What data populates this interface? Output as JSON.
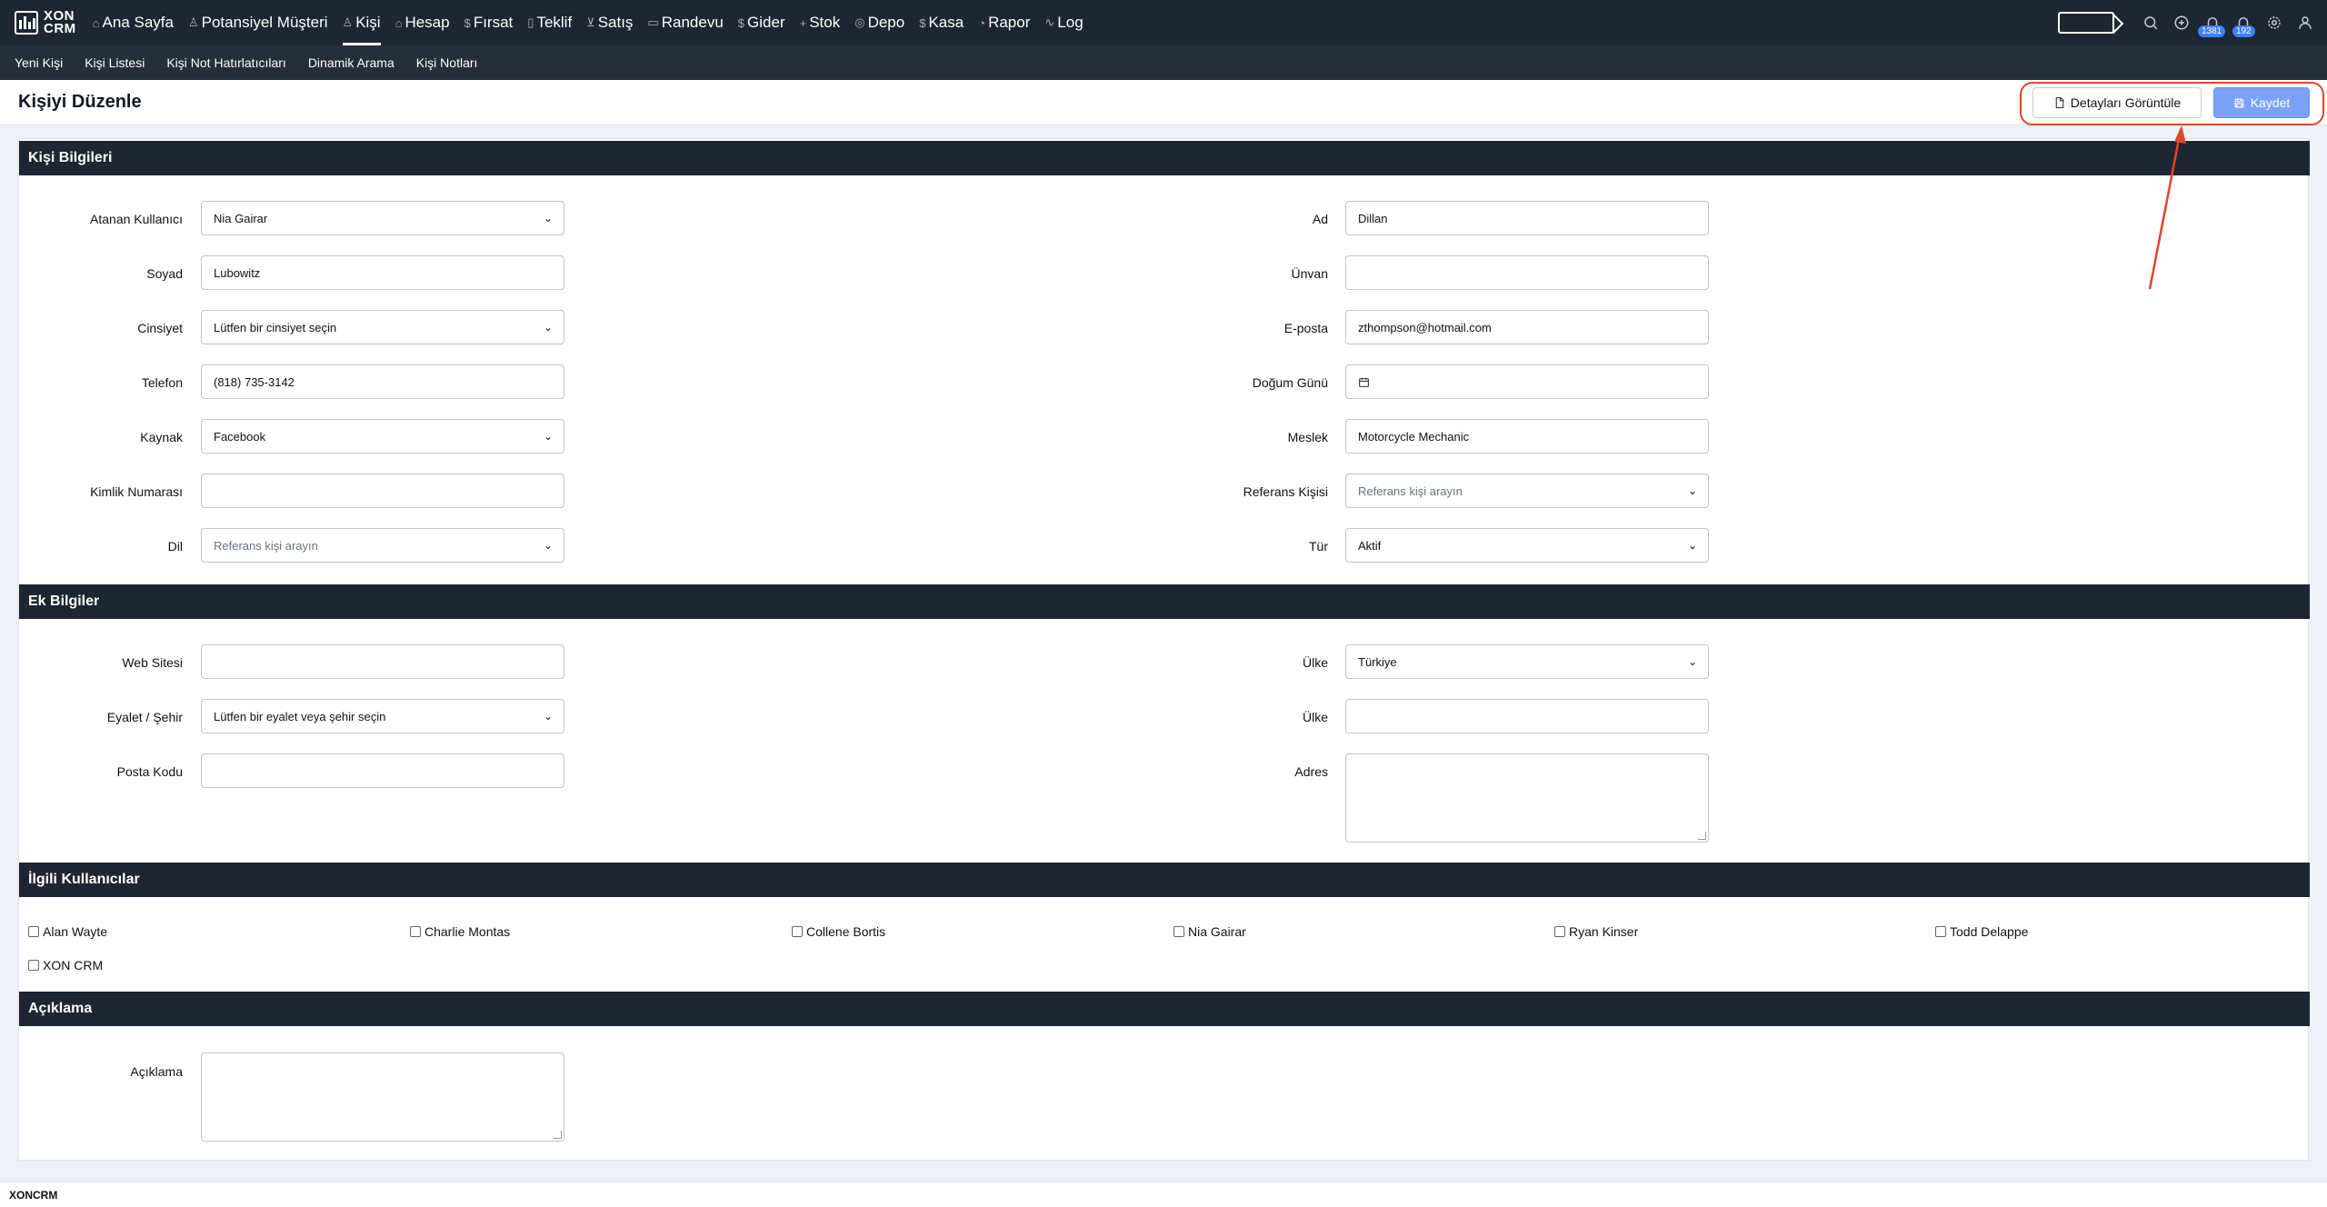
{
  "app": {
    "logo_line1": "XON",
    "logo_line2": "CRM"
  },
  "nav": {
    "items": [
      {
        "label": "Ana Sayfa",
        "icon": "home-icon",
        "glyph": "⌂"
      },
      {
        "label": "Potansiyel Müşteri",
        "icon": "user-icon",
        "glyph": "♙"
      },
      {
        "label": "Kişi",
        "icon": "users-icon",
        "glyph": "♙"
      },
      {
        "label": "Hesap",
        "icon": "building-icon",
        "glyph": "⌂"
      },
      {
        "label": "Fırsat",
        "icon": "dollar-icon",
        "glyph": "$"
      },
      {
        "label": "Teklif",
        "icon": "document-icon",
        "glyph": "▯"
      },
      {
        "label": "Satış",
        "icon": "cart-icon",
        "glyph": "⊻"
      },
      {
        "label": "Randevu",
        "icon": "calendar-icon",
        "glyph": "▭"
      },
      {
        "label": "Gider",
        "icon": "dollar-icon",
        "glyph": "$"
      },
      {
        "label": "Stok",
        "icon": "plus-icon",
        "glyph": "+"
      },
      {
        "label": "Depo",
        "icon": "package-icon",
        "glyph": "◎"
      },
      {
        "label": "Kasa",
        "icon": "dollar-icon",
        "glyph": "$"
      },
      {
        "label": "Rapor",
        "icon": "pie-chart-icon",
        "glyph": "◔"
      },
      {
        "label": "Log",
        "icon": "activity-icon",
        "glyph": "∿"
      }
    ],
    "active_index": 2,
    "badges": {
      "notifications": "1381",
      "alerts": "192"
    }
  },
  "subnav": [
    "Yeni Kişi",
    "Kişi Listesi",
    "Kişi Not Hatırlatıcıları",
    "Dinamik Arama",
    "Kişi Notları"
  ],
  "header": {
    "title": "Kişiyi Düzenle",
    "details_button": "Detayları Görüntüle",
    "save_button": "Kaydet"
  },
  "sections": {
    "contact_info": "Kişi Bilgileri",
    "extra_info": "Ek Bilgiler",
    "related_users": "İlgili Kullanıcılar",
    "description": "Açıklama"
  },
  "form": {
    "assigned_user": {
      "label": "Atanan Kullanıcı",
      "value": "Nia Gairar"
    },
    "first_name": {
      "label": "Ad",
      "value": "Dillan"
    },
    "last_name": {
      "label": "Soyad",
      "value": "Lubowitz"
    },
    "title": {
      "label": "Ünvan",
      "value": ""
    },
    "gender": {
      "label": "Cinsiyet",
      "value": "Lütfen bir cinsiyet seçin"
    },
    "email": {
      "label": "E-posta",
      "value": "zthompson@hotmail.com"
    },
    "phone": {
      "label": "Telefon",
      "value": "(818) 735-3142"
    },
    "birthday": {
      "label": "Doğum Günü",
      "value": ""
    },
    "source": {
      "label": "Kaynak",
      "value": "Facebook"
    },
    "occupation": {
      "label": "Meslek",
      "value": "Motorcycle Mechanic"
    },
    "id_number": {
      "label": "Kimlik Numarası",
      "value": ""
    },
    "reference": {
      "label": "Referans Kişisi",
      "placeholder": "Referans kişi arayın"
    },
    "language": {
      "label": "Dil",
      "placeholder": "Referans kişi arayın"
    },
    "type": {
      "label": "Tür",
      "value": "Aktif"
    },
    "website": {
      "label": "Web Sitesi",
      "value": ""
    },
    "country_select": {
      "label": "Ülke",
      "value": "Türkiye"
    },
    "state_city": {
      "label": "Eyalet / Şehir",
      "value": "Lütfen bir eyalet veya şehir seçin"
    },
    "country_text": {
      "label": "Ülke",
      "value": ""
    },
    "postal_code": {
      "label": "Posta Kodu",
      "value": ""
    },
    "address": {
      "label": "Adres",
      "value": ""
    },
    "description": {
      "label": "Açıklama",
      "value": ""
    }
  },
  "related_users": [
    "Alan Wayte",
    "Charlie Montas",
    "Collene Bortis",
    "Nia Gairar",
    "Ryan Kinser",
    "Todd Delappe",
    "XON CRM"
  ],
  "footer": {
    "text": "XONCRM"
  },
  "colors": {
    "nav_bg": "#1e2533",
    "accent": "#7ba2f7",
    "annotation": "#e2452b"
  }
}
